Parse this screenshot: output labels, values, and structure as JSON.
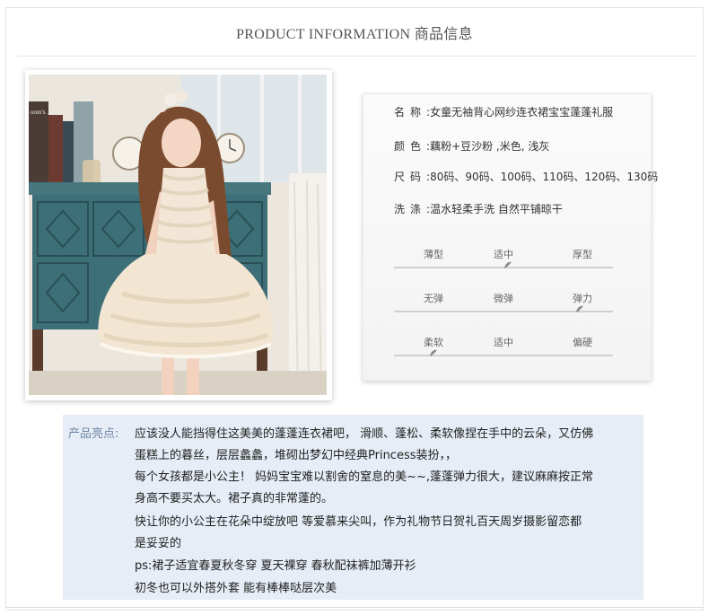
{
  "header": {
    "title": "PRODUCT INFORMATION 商品信息"
  },
  "info": {
    "rows": [
      {
        "key": "名称",
        "sep": ":",
        "value": "女童无袖背心网纱连衣裙宝宝蓬蓬礼服"
      },
      {
        "key": "颜色",
        "sep": ":",
        "value": "藕粉+豆沙粉  ,米色, 浅灰"
      },
      {
        "key": "尺码",
        "sep": ":",
        "value": "80码、90码、100码、110码、120码、130码"
      },
      {
        "key": "洗涤",
        "sep": ":",
        "value": "温水轻柔手洗 自然平铺晾干"
      }
    ],
    "scales": [
      {
        "labels": [
          "薄型",
          "适中",
          "厚型"
        ],
        "level": 0.52
      },
      {
        "labels": [
          "无弹",
          "微弹",
          "弹力"
        ],
        "level": 0.85
      },
      {
        "labels": [
          "柔软",
          "适中",
          "偏硬"
        ],
        "level": 0.18
      }
    ]
  },
  "highlights": {
    "label": "产品亮点:",
    "lines": [
      "应该没人能挡得住这美美的蓬蓬连衣裙吧， 滑顺、蓬松、柔软像捏在手中的云朵，又仿佛",
      "蛋糕上的暮丝，层层蠡蠡，堆砌出梦幻中经典Princess装扮，，",
      "每个女孩都是小公主！ 妈妈宝宝难以割舍的窒息的美~~,蓬蓬弹力很大，建议麻麻按正常",
      "身高不要买太大。裙子真的非常蓬的。",
      "快让你的小公主在花朵中绽放吧   等爱慕来尖叫，作为礼物节日贺礼百天周岁摄影留恋都",
      "是妥妥的",
      "ps:裙子适宜春夏秋冬穿 夏天裸穿 春秋配袜裤加薄开衫",
      "初冬也可以外搭外套 能有棒棒哒层次美"
    ]
  },
  "photo": {
    "book_title": "oom's ...",
    "colors": {
      "cabinet": "#3d6f78",
      "skirt": "#f2e6d2",
      "wall": "#ece7df"
    }
  }
}
